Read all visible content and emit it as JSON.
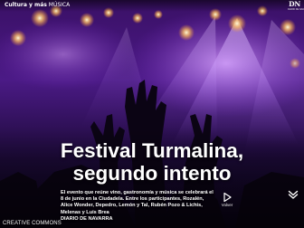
{
  "header": {
    "section": "Cultura y más",
    "subsection": "MÚSICA",
    "logo": "DN",
    "logo_subtitle": "DIARIO DE NAVARRA"
  },
  "article": {
    "headline_line1": "Festival Turmalina,",
    "headline_line2": "segundo intento",
    "summary": "El evento que reúne vino, gastronomía y música se celebrará el 8 de junio en la Ciudadela. Entre los participantes, Rozalén, Alice Wonder, Depedro, Lemón y Tal, Rubén Pozo & Lichis, Melenas y Luis Brea",
    "source": "DIARIO DE NAVARRA"
  },
  "controls": {
    "play_label": "Volver",
    "play_icon": "play-icon",
    "next_icon": "chevron-down-icon"
  },
  "footer": {
    "license": "CREATIVE COMMONS"
  }
}
